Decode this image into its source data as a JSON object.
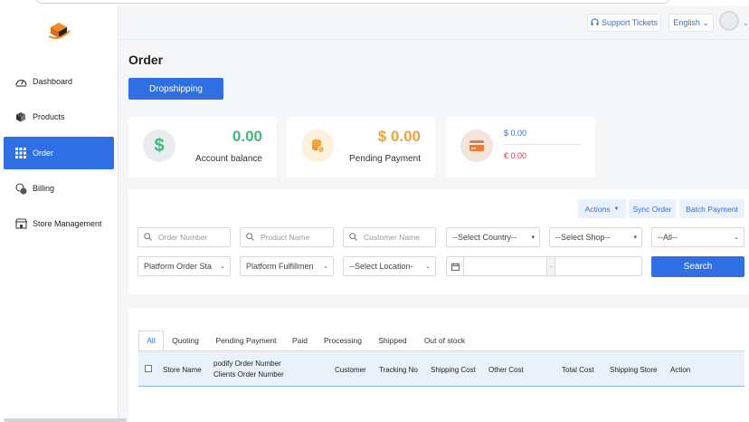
{
  "sidebar": {
    "items": [
      {
        "label": "Dashboard",
        "icon": "dashboard-icon"
      },
      {
        "label": "Products",
        "icon": "box-icon"
      },
      {
        "label": "Order",
        "icon": "grid-icon"
      },
      {
        "label": "Billing",
        "icon": "coins-icon"
      },
      {
        "label": "Store Management",
        "icon": "store-icon"
      }
    ]
  },
  "header": {
    "support_label": "Support Tickets",
    "language_label": "English"
  },
  "page": {
    "title": "Order",
    "dropshipping_label": "Dropshipping"
  },
  "cards": {
    "balance_value": "0.00",
    "balance_label": "Account balance",
    "pending_value": "$ 0.00",
    "pending_label": "Pending Payment",
    "usd_value": "$ 0.00",
    "eur_value": "€ 0.00"
  },
  "actions": {
    "actions_label": "Actions",
    "sync_label": "Sync Order",
    "batch_label": "Batch Payment"
  },
  "filters": {
    "order_number_placeholder": "Order Number",
    "product_name_placeholder": "Product Name",
    "customer_name_placeholder": "Customer Name",
    "country_value": "--Select Country--",
    "shop_value": "--Select Shop--",
    "all_value": "--All--",
    "platform_status_value": "Platform Order Sta",
    "fulfillment_value": "Platform Fulfillmen",
    "location_value": "--Select Location-",
    "date_separator": "-",
    "search_label": "Search"
  },
  "tabs": [
    "All",
    "Quoting",
    "Pending Payment",
    "Paid",
    "Processing",
    "Shipped",
    "Out of stock"
  ],
  "table": {
    "columns": [
      "Store Name",
      "podify Order Number",
      "Clients Order Number",
      "Customer",
      "Tracking No",
      "Shipping Cost",
      "Other Cost",
      "Total Cost",
      "Shipping Store",
      "Action"
    ]
  },
  "colors": {
    "accent": "#2f6fe4",
    "balance_green": "#3dbb7a",
    "pending_orange": "#f0a33a",
    "eur_red": "#e0344a"
  }
}
